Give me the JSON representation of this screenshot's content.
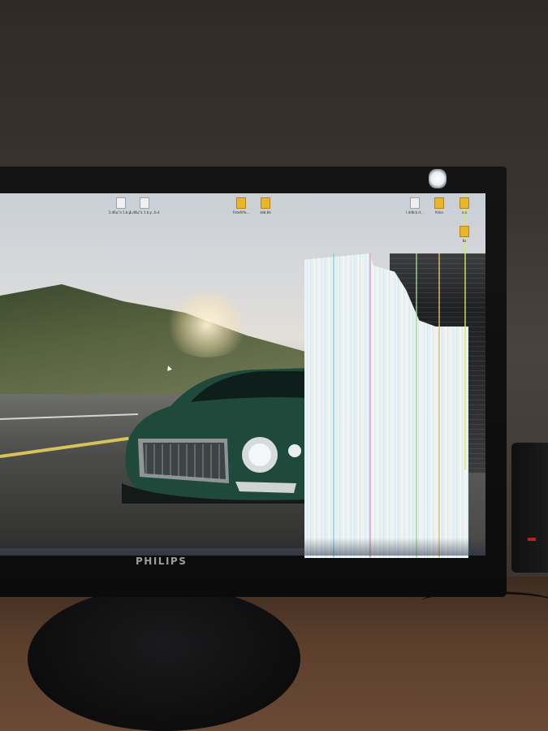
{
  "monitor": {
    "brand": "PHILIPS"
  },
  "desktop": {
    "icons": [
      {
        "name": "file-icon",
        "type": "file",
        "label": "1.d0ц°а 1.b.y..."
      },
      {
        "name": "file-icon",
        "type": "file",
        "label": "1.d0ц°а 1.b.y...b.d"
      },
      {
        "name": "folder-icon",
        "type": "folder",
        "label": "Fotoðrfo..."
      },
      {
        "name": "folder-icon",
        "type": "folder",
        "label": "sbb.bb"
      },
      {
        "name": "file-icon",
        "type": "file",
        "label": "l.ddb.b.d..."
      },
      {
        "name": "folder-icon",
        "type": "folder",
        "label": "Knko"
      },
      {
        "name": "folder-icon",
        "type": "folder",
        "label": "o.o"
      },
      {
        "name": "folder-icon",
        "type": "folder",
        "label": "Ko"
      }
    ]
  },
  "colors": {
    "car_body": "#1f4a3b",
    "glitch_tint": "#e8f2f5",
    "folder": "#e9b52a",
    "speaker_led": "#b5241c"
  }
}
